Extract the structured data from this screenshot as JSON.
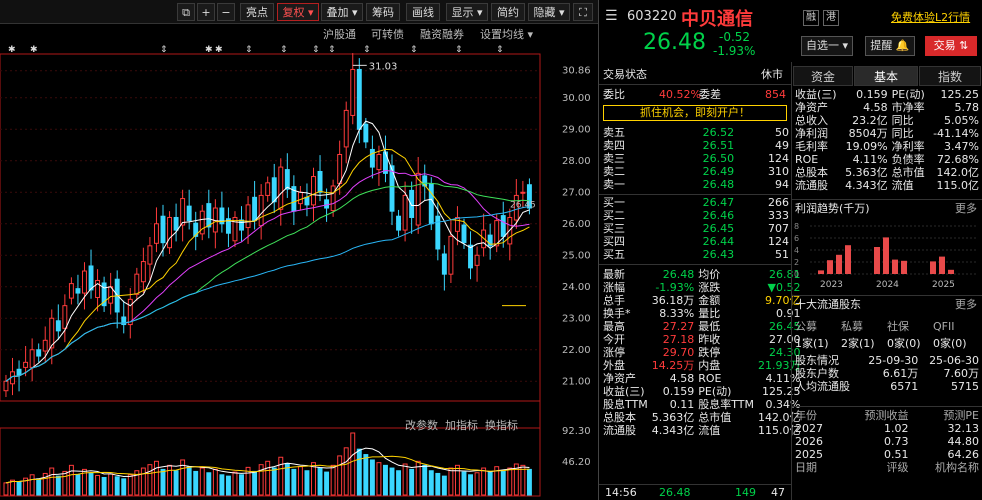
{
  "toolbar": {
    "buttons": [
      "亮点",
      "复权 ▾",
      "叠加 ▾",
      "筹码",
      "画线",
      "显示 ▾",
      "简约",
      "隐藏 ▾"
    ],
    "sub_tabs": [
      "沪股通",
      "可转债",
      "融资融券",
      "设置均线 ▾"
    ],
    "bottom_tabs": [
      "改参数",
      "加指标",
      "换指标"
    ]
  },
  "header": {
    "code": "603220",
    "name": "中贝通信",
    "price": "26.48",
    "change": "-0.52",
    "change_pct": "-1.93%",
    "badge_margin": "融",
    "badge_hk": "港",
    "promo_link": "免费体验L2行情",
    "watchlist_label": "自选一",
    "remind_label": "提醒",
    "trade_label": "交易"
  },
  "status": {
    "label": "交易状态",
    "value": "休市",
    "ratio_label": "委比",
    "ratio_value": "40.52%",
    "diff_label": "委差",
    "diff_value": "854",
    "promo": "抓住机会，即刻开户！"
  },
  "order_book": {
    "asks": [
      {
        "label": "卖五",
        "price": "26.52",
        "vol": "50"
      },
      {
        "label": "卖四",
        "price": "26.51",
        "vol": "49"
      },
      {
        "label": "卖三",
        "price": "26.50",
        "vol": "124"
      },
      {
        "label": "卖二",
        "price": "26.49",
        "vol": "310"
      },
      {
        "label": "卖一",
        "price": "26.48",
        "vol": "94"
      }
    ],
    "bids": [
      {
        "label": "买一",
        "price": "26.47",
        "vol": "266"
      },
      {
        "label": "买二",
        "price": "26.46",
        "vol": "333"
      },
      {
        "label": "买三",
        "price": "26.45",
        "vol": "707"
      },
      {
        "label": "买四",
        "price": "26.44",
        "vol": "124"
      },
      {
        "label": "买五",
        "price": "26.43",
        "vol": "51"
      }
    ]
  },
  "stats": [
    [
      "最新",
      "26.48",
      "均价",
      "26.81"
    ],
    [
      "涨幅",
      "-1.93%",
      "涨跌",
      "▼0.52"
    ],
    [
      "总手",
      "36.18万",
      "金额",
      "9.70亿"
    ],
    [
      "换手*",
      "8.33%",
      "量比",
      "0.91"
    ],
    [
      "最高",
      "27.27",
      "最低",
      "26.45"
    ],
    [
      "今开",
      "27.18",
      "昨收",
      "27.00"
    ],
    [
      "涨停",
      "29.70",
      "跌停",
      "24.30"
    ],
    [
      "外盘",
      "14.25万",
      "内盘",
      "21.93万"
    ],
    [
      "净资产",
      "4.58",
      "ROE",
      "4.11%"
    ],
    [
      "收益(三)",
      "0.159",
      "PE(动)",
      "125.25"
    ],
    [
      "股息TTM",
      "0.11",
      "股息率TTM",
      "0.34%"
    ],
    [
      "总股本",
      "5.363亿",
      "总市值",
      "142.0亿"
    ],
    [
      "流通股",
      "4.343亿",
      "流值",
      "115.0亿"
    ]
  ],
  "last_trade": {
    "time": "14:56",
    "price": "26.48",
    "vol": "149",
    "count": "47"
  },
  "fin_tabs": [
    "资金",
    "基本",
    "指数"
  ],
  "fundamentals": [
    [
      "收益(三)",
      "0.159",
      "PE(动)",
      "125.25"
    ],
    [
      "净资产",
      "4.58",
      "市净率",
      "5.78"
    ],
    [
      "总收入",
      "23.2亿",
      "同比",
      "5.05%"
    ],
    [
      "净利润",
      "8504万",
      "同比",
      "-41.14%"
    ],
    [
      "毛利率",
      "19.09%",
      "净利率",
      "3.47%"
    ],
    [
      "ROE",
      "4.11%",
      "负债率",
      "72.68%"
    ],
    [
      "总股本",
      "5.363亿",
      "总市值",
      "142.0亿"
    ],
    [
      "流通股",
      "4.343亿",
      "流值",
      "115.0亿"
    ]
  ],
  "profit_trend": {
    "title": "利润趋势(千万)",
    "more": "更多",
    "years": [
      "2023",
      "2024",
      "2025"
    ],
    "yticks": [
      "8",
      "6",
      "4",
      "2",
      "0"
    ]
  },
  "shareholders": {
    "title": "十大流通股东",
    "more": "更多",
    "cols": [
      "公募",
      "私募",
      "社保",
      "QFII"
    ],
    "vals": [
      "1家(1)",
      "2家(1)",
      "0家(0)",
      "0家(0)"
    ],
    "rows": [
      [
        "股东情况",
        "25-09-30",
        "25-06-30"
      ],
      [
        "股东户数",
        "6.61万",
        "7.60万"
      ],
      [
        "人均流通股",
        "6571",
        "5715"
      ]
    ]
  },
  "forecast": {
    "headers": [
      "年份",
      "预测收益",
      "预测PE"
    ],
    "rows": [
      [
        "2027",
        "1.02",
        "32.13"
      ],
      [
        "2026",
        "0.73",
        "44.80"
      ],
      [
        "2025",
        "0.51",
        "64.26"
      ]
    ],
    "footer": [
      "日期",
      "评级",
      "机构名称"
    ]
  },
  "chart_data": {
    "type": "candlestick",
    "ylim": [
      20.5,
      31.2
    ],
    "y_ticks": [
      30.86,
      30.0,
      29.0,
      28.0,
      27.0,
      26.0,
      25.0,
      24.0,
      23.0,
      22.0,
      21.0
    ],
    "annotation_high": "31.03",
    "annotation_ma": "26.45",
    "volume_ticks": [
      "92.30",
      "46.20"
    ],
    "closes": [
      21.0,
      21.3,
      21.2,
      21.6,
      22.0,
      21.8,
      22.3,
      23.0,
      22.6,
      23.4,
      24.1,
      23.8,
      24.5,
      23.9,
      24.2,
      23.4,
      24.0,
      23.2,
      22.8,
      23.6,
      24.4,
      24.8,
      25.3,
      26.0,
      25.4,
      26.2,
      25.8,
      26.8,
      26.1,
      25.6,
      26.4,
      25.9,
      26.5,
      26.0,
      25.7,
      26.2,
      25.8,
      26.6,
      26.1,
      26.9,
      27.3,
      26.7,
      27.8,
      27.1,
      26.4,
      27.0,
      26.6,
      27.5,
      27.0,
      26.5,
      27.2,
      28.2,
      29.6,
      30.9,
      29.0,
      28.6,
      27.8,
      28.2,
      27.6,
      26.4,
      25.8,
      26.9,
      26.2,
      27.6,
      27.2,
      26.0,
      25.2,
      24.4,
      25.6,
      26.2,
      25.4,
      24.6,
      25.0,
      25.8,
      25.3,
      26.1,
      25.6,
      26.2,
      26.9,
      27.0,
      26.5
    ],
    "volumes": [
      18,
      22,
      20,
      25,
      30,
      24,
      32,
      40,
      28,
      35,
      44,
      30,
      38,
      33,
      29,
      26,
      31,
      27,
      24,
      30,
      36,
      40,
      45,
      50,
      38,
      44,
      36,
      52,
      42,
      35,
      40,
      33,
      38,
      30,
      28,
      34,
      30,
      41,
      35,
      45,
      50,
      40,
      56,
      46,
      38,
      42,
      36,
      48,
      40,
      34,
      44,
      58,
      70,
      92,
      68,
      60,
      52,
      48,
      44,
      40,
      36,
      46,
      38,
      50,
      44,
      36,
      32,
      28,
      40,
      44,
      34,
      30,
      33,
      40,
      35,
      42,
      36,
      40,
      46,
      44,
      38
    ]
  }
}
